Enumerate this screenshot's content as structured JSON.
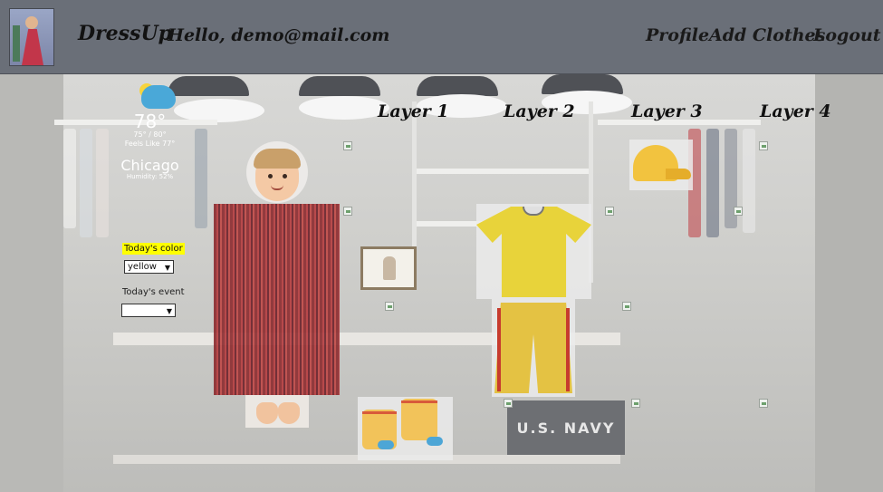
{
  "header": {
    "brand": "DressUp",
    "greeting": "Hello, demo@mail.com",
    "nav": [
      "Profile",
      "Add Clothes",
      "Logout"
    ]
  },
  "weather": {
    "temperature": "78°",
    "range": "75° / 80°",
    "feels_like": "Feels Like 77°",
    "city": "Chicago",
    "humidity": "Humidity: 52%",
    "icon": "partly-cloudy-icon"
  },
  "controls": {
    "color_label": "Today's color",
    "color_value": "yellow",
    "event_label": "Today's event",
    "event_value": ""
  },
  "layers": [
    "Layer 1",
    "Layer 2",
    "Layer 3",
    "Layer 4"
  ],
  "background": {
    "sign_text": "U.S. NAVY"
  },
  "colors": {
    "header_bg": "#6a6f78",
    "highlight": "#ffff00",
    "dress": "#a83538",
    "shirt": "#e8d33a",
    "cap": "#f2c33f"
  }
}
